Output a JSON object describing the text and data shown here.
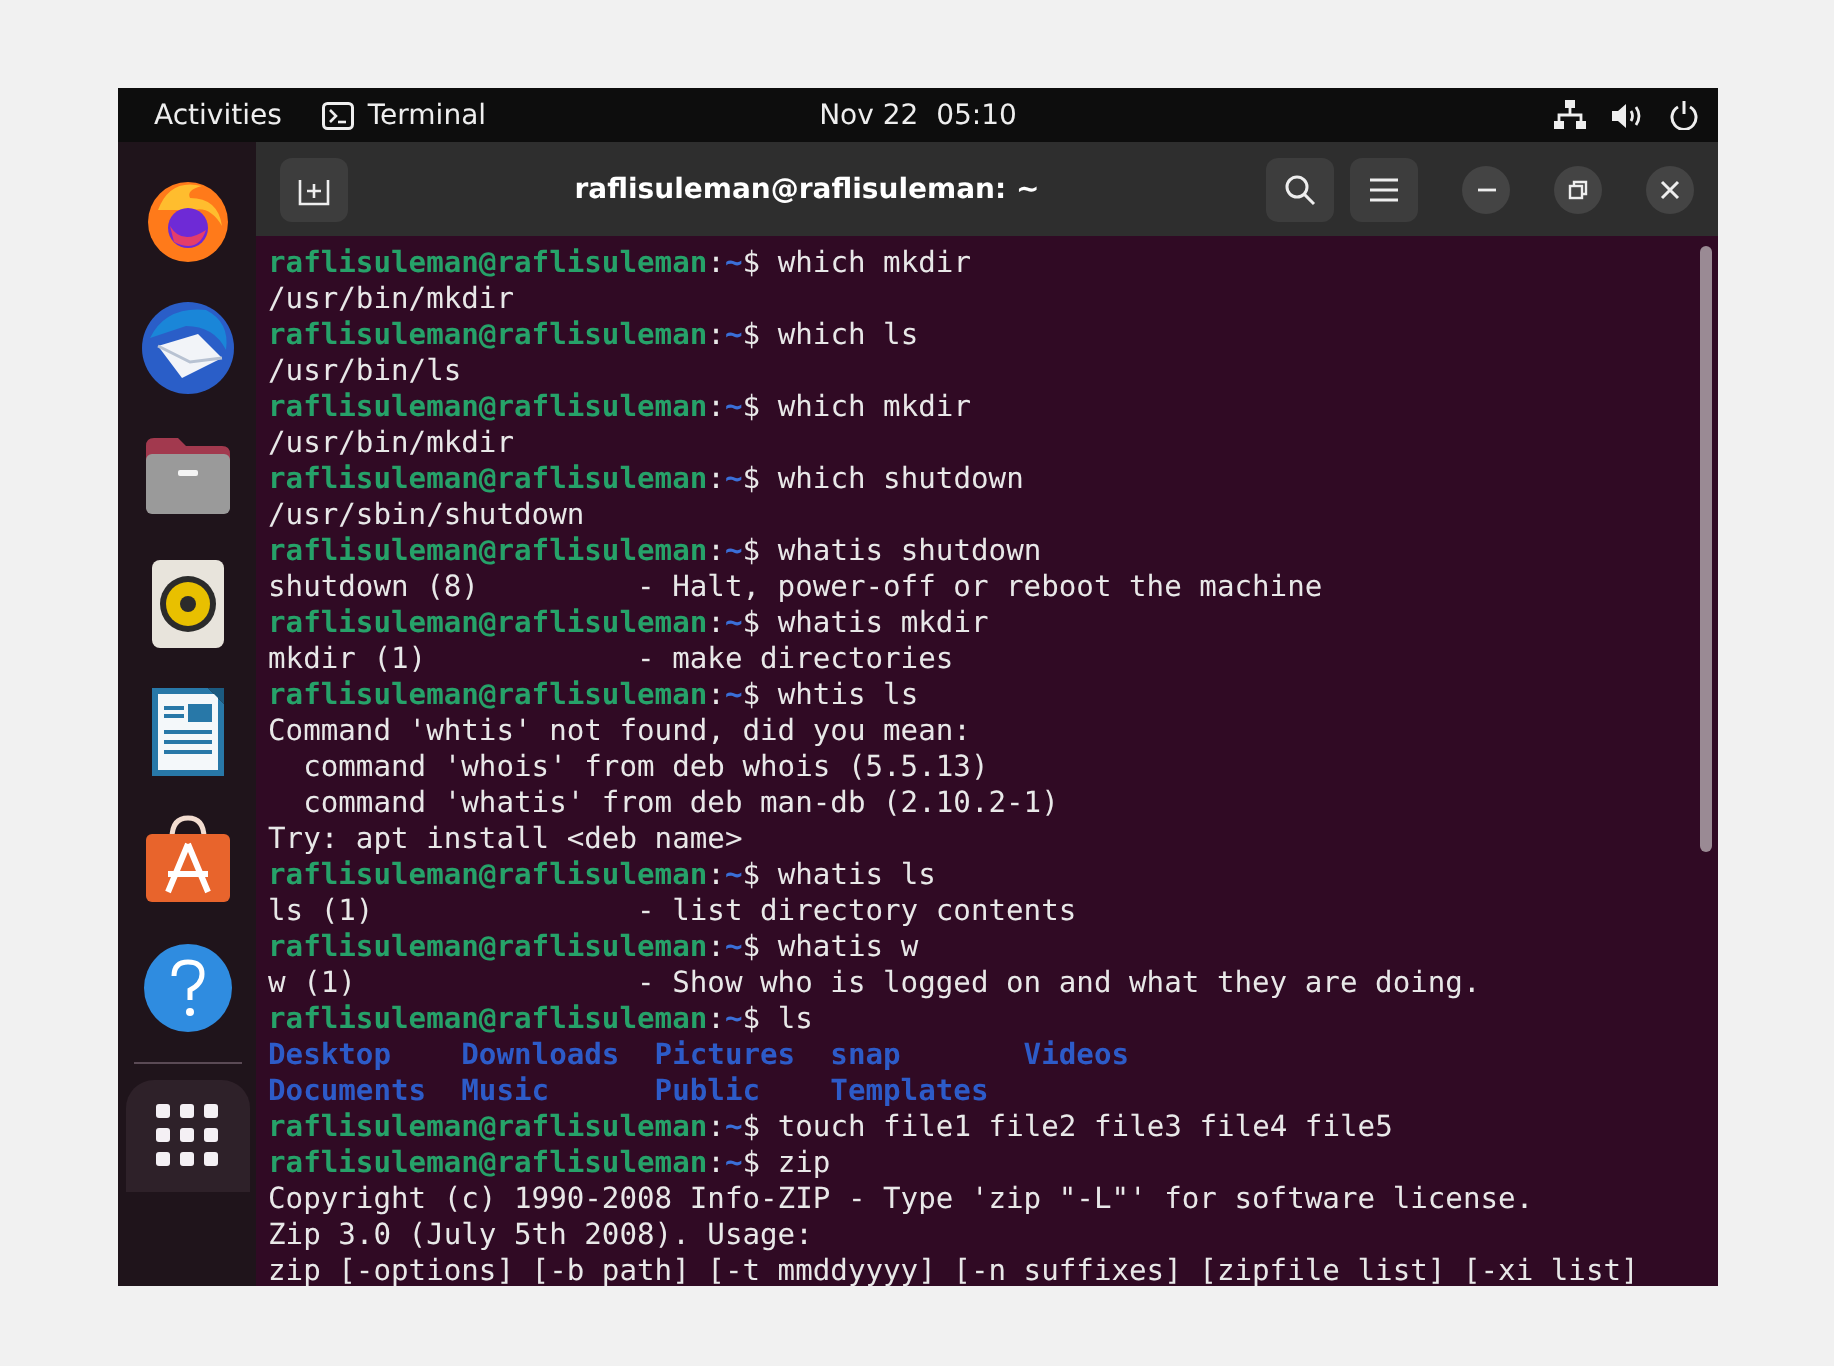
{
  "top_bar": {
    "activities": "Activities",
    "app_name": "Terminal",
    "clock": "Nov 22  05:10"
  },
  "dock": {
    "items": [
      {
        "kind": "firefox"
      },
      {
        "kind": "thunderbird"
      },
      {
        "kind": "files"
      },
      {
        "kind": "rhythmbox"
      },
      {
        "kind": "writer"
      },
      {
        "kind": "appcenter"
      },
      {
        "kind": "help"
      },
      {
        "kind": "apps"
      }
    ]
  },
  "window": {
    "title": "raflisuleman@raflisuleman: ~"
  },
  "terminal": {
    "lines": [
      {
        "kind": "prompt",
        "host": "raflisuleman@raflisuleman",
        "colon": ":",
        "path": "~",
        "sign": "$",
        "command": "which mkdir"
      },
      {
        "kind": "output",
        "text": "/usr/bin/mkdir"
      },
      {
        "kind": "prompt",
        "host": "raflisuleman@raflisuleman",
        "colon": ":",
        "path": "~",
        "sign": "$",
        "command": "which ls"
      },
      {
        "kind": "output",
        "text": "/usr/bin/ls"
      },
      {
        "kind": "prompt",
        "host": "raflisuleman@raflisuleman",
        "colon": ":",
        "path": "~",
        "sign": "$",
        "command": "which mkdir"
      },
      {
        "kind": "output",
        "text": "/usr/bin/mkdir"
      },
      {
        "kind": "prompt",
        "host": "raflisuleman@raflisuleman",
        "colon": ":",
        "path": "~",
        "sign": "$",
        "command": "which shutdown"
      },
      {
        "kind": "output",
        "text": "/usr/sbin/shutdown"
      },
      {
        "kind": "prompt",
        "host": "raflisuleman@raflisuleman",
        "colon": ":",
        "path": "~",
        "sign": "$",
        "command": "whatis shutdown"
      },
      {
        "kind": "output",
        "text": "shutdown (8)         - Halt, power-off or reboot the machine"
      },
      {
        "kind": "prompt",
        "host": "raflisuleman@raflisuleman",
        "colon": ":",
        "path": "~",
        "sign": "$",
        "command": "whatis mkdir"
      },
      {
        "kind": "output",
        "text": "mkdir (1)            - make directories"
      },
      {
        "kind": "prompt",
        "host": "raflisuleman@raflisuleman",
        "colon": ":",
        "path": "~",
        "sign": "$",
        "command": "whtis ls"
      },
      {
        "kind": "output",
        "text": "Command 'whtis' not found, did you mean:"
      },
      {
        "kind": "output",
        "text": "  command 'whois' from deb whois (5.5.13)"
      },
      {
        "kind": "output",
        "text": "  command 'whatis' from deb man-db (2.10.2-1)"
      },
      {
        "kind": "output",
        "text": "Try: apt install <deb name>"
      },
      {
        "kind": "prompt",
        "host": "raflisuleman@raflisuleman",
        "colon": ":",
        "path": "~",
        "sign": "$",
        "command": "whatis ls"
      },
      {
        "kind": "output",
        "text": "ls (1)               - list directory contents"
      },
      {
        "kind": "prompt",
        "host": "raflisuleman@raflisuleman",
        "colon": ":",
        "path": "~",
        "sign": "$",
        "command": "whatis w"
      },
      {
        "kind": "output",
        "text": "w (1)                - Show who is logged on and what they are doing."
      },
      {
        "kind": "prompt",
        "host": "raflisuleman@raflisuleman",
        "colon": ":",
        "path": "~",
        "sign": "$",
        "command": "ls"
      },
      {
        "kind": "dirs",
        "text": "Desktop    Downloads  Pictures  snap       Videos"
      },
      {
        "kind": "dirs",
        "text": "Documents  Music      Public    Templates"
      },
      {
        "kind": "prompt",
        "host": "raflisuleman@raflisuleman",
        "colon": ":",
        "path": "~",
        "sign": "$",
        "command": "touch file1 file2 file3 file4 file5"
      },
      {
        "kind": "prompt",
        "host": "raflisuleman@raflisuleman",
        "colon": ":",
        "path": "~",
        "sign": "$",
        "command": "zip"
      },
      {
        "kind": "output",
        "text": "Copyright (c) 1990-2008 Info-ZIP - Type 'zip \"-L\"' for software license."
      },
      {
        "kind": "output",
        "text": "Zip 3.0 (July 5th 2008). Usage:"
      },
      {
        "kind": "output",
        "text": "zip [-options] [-b path] [-t mmddyyyy] [-n suffixes] [zipfile list] [-xi list]"
      }
    ]
  }
}
